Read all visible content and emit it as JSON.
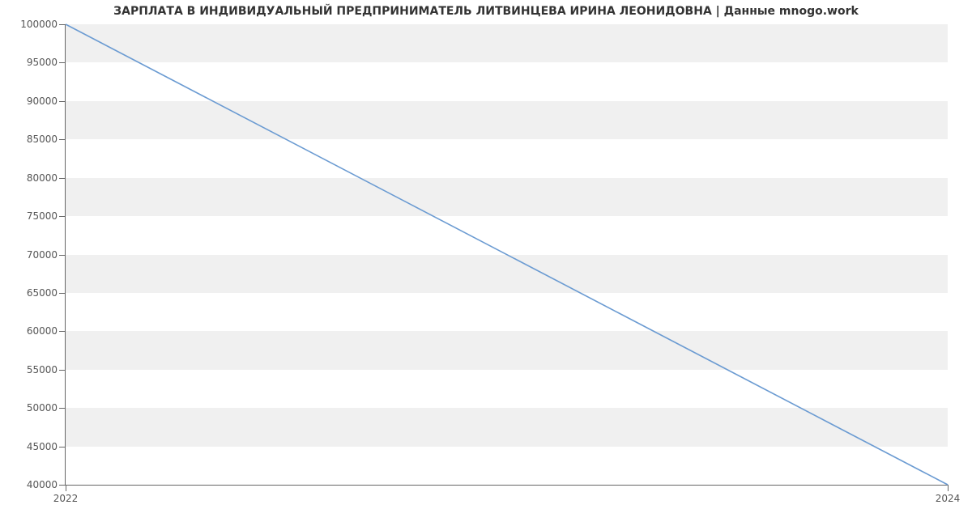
{
  "chart_data": {
    "type": "line",
    "title": "ЗАРПЛАТА В ИНДИВИДУАЛЬНЫЙ ПРЕДПРИНИМАТЕЛЬ ЛИТВИНЦЕВА ИРИНА ЛЕОНИДОВНА | Данные mnogo.work",
    "x": [
      2022,
      2024
    ],
    "values": [
      100000,
      40000
    ],
    "xlabel": "",
    "ylabel": "",
    "xlim": [
      2022,
      2024
    ],
    "ylim": [
      40000,
      100000
    ],
    "y_ticks": [
      40000,
      45000,
      50000,
      55000,
      60000,
      65000,
      70000,
      75000,
      80000,
      85000,
      90000,
      95000,
      100000
    ],
    "x_ticks": [
      2022,
      2024
    ],
    "line_color": "#6b9bd2",
    "band_color": "#f0f0f0"
  }
}
